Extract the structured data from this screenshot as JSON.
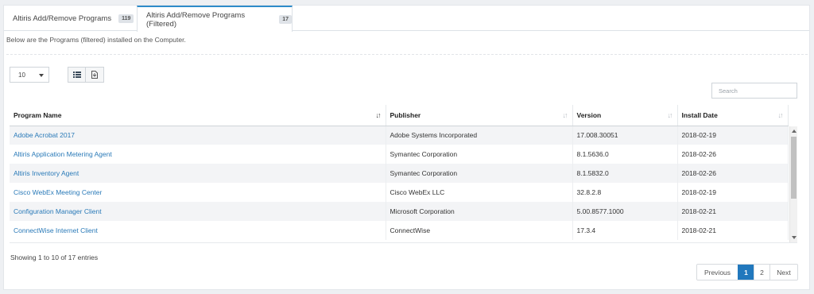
{
  "tabs": [
    {
      "label": "Altiris Add/Remove Programs",
      "count": "119"
    },
    {
      "label": "Altiris Add/Remove Programs (Filtered)",
      "count": "17"
    }
  ],
  "description": "Below are the Programs (filtered) installed on the Computer.",
  "page_size": {
    "value": "10"
  },
  "search": {
    "placeholder": "Search"
  },
  "table": {
    "columns": [
      "Program Name",
      "Publisher",
      "Version",
      "Install Date"
    ],
    "rows": [
      [
        "Adobe Acrobat 2017",
        "Adobe Systems Incorporated",
        "17.008.30051",
        "2018-02-19"
      ],
      [
        "Altiris Application Metering Agent",
        "Symantec Corporation",
        "8.1.5636.0",
        "2018-02-26"
      ],
      [
        "Altiris Inventory Agent",
        "Symantec Corporation",
        "8.1.5832.0",
        "2018-02-26"
      ],
      [
        "Cisco WebEx Meeting Center",
        "Cisco WebEx LLC",
        "32.8.2.8",
        "2018-02-19"
      ],
      [
        "Configuration Manager Client",
        "Microsoft Corporation",
        "5.00.8577.1000",
        "2018-02-21"
      ],
      [
        "ConnectWise Internet Client",
        "ConnectWise",
        "17.3.4",
        "2018-02-21"
      ]
    ]
  },
  "info": "Showing 1 to 10 of 17 entries",
  "pagination": {
    "previous": "Previous",
    "pages": [
      "1",
      "2"
    ],
    "next": "Next",
    "current": "1"
  },
  "colors": {
    "accent": "#2178bd",
    "link": "#2a7ab8"
  },
  "icons": {
    "list_view": "list-icon",
    "export": "export-document-icon"
  }
}
